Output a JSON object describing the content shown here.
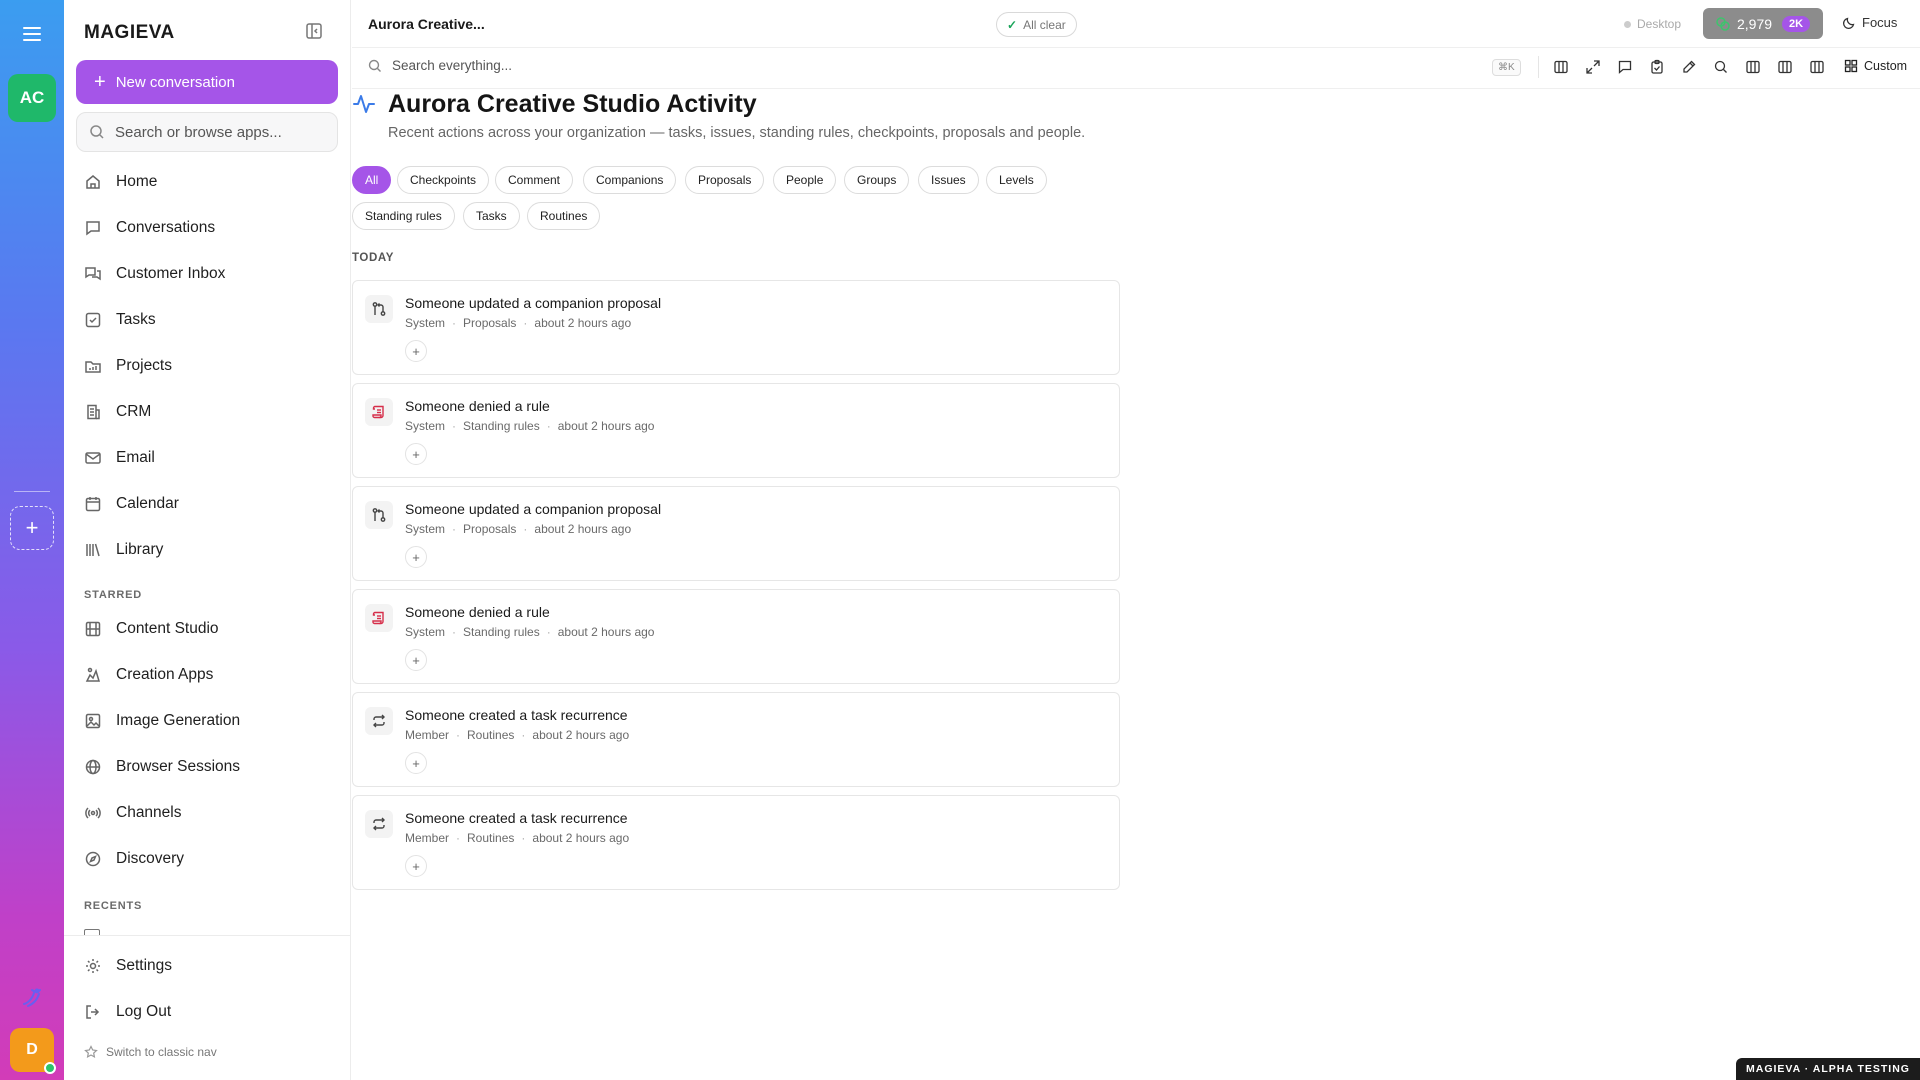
{
  "rail": {
    "workspace_initials": "AC",
    "user_initial": "D",
    "add_label": "+"
  },
  "sidebar": {
    "brand": "MAGIEVA",
    "new_conversation": "New conversation",
    "search_placeholder": "Search or browse apps...",
    "items": [
      {
        "label": "Home",
        "icon": "home-icon"
      },
      {
        "label": "Conversations",
        "icon": "chat-icon"
      },
      {
        "label": "Customer Inbox",
        "icon": "inbox-icon"
      },
      {
        "label": "Tasks",
        "icon": "checkbox-icon"
      },
      {
        "label": "Projects",
        "icon": "folder-icon"
      },
      {
        "label": "CRM",
        "icon": "building-icon"
      },
      {
        "label": "Email",
        "icon": "mail-icon"
      },
      {
        "label": "Calendar",
        "icon": "calendar-icon"
      },
      {
        "label": "Library",
        "icon": "library-icon"
      }
    ],
    "starred_label": "STARRED",
    "starred": [
      {
        "label": "Content Studio",
        "icon": "film-icon"
      },
      {
        "label": "Creation Apps",
        "icon": "apps-icon"
      },
      {
        "label": "Image Generation",
        "icon": "image-icon"
      },
      {
        "label": "Browser Sessions",
        "icon": "globe-icon"
      },
      {
        "label": "Channels",
        "icon": "broadcast-icon"
      },
      {
        "label": "Discovery",
        "icon": "compass-icon"
      }
    ],
    "recents_label": "RECENTS",
    "footer": {
      "settings": "Settings",
      "logout": "Log Out",
      "classic": "Switch to classic nav"
    }
  },
  "topbar": {
    "breadcrumb": "Aurora Creative...",
    "status": "All clear",
    "desktop": "Desktop",
    "credits": "2,979",
    "credits_badge": "2K",
    "focus": "Focus"
  },
  "searchbar": {
    "placeholder": "Search everything...",
    "shortcut": "⌘K",
    "custom": "Custom"
  },
  "page": {
    "title": "Aurora Creative Studio Activity",
    "subtitle": "Recent actions across your organization — tasks, issues, standing rules, checkpoints, proposals and people.",
    "filters_row1": [
      "All",
      "Checkpoints",
      "Comment",
      "Companions",
      "Proposals",
      "People",
      "Groups",
      "Issues",
      "Levels"
    ],
    "filters_row2": [
      "Standing rules",
      "Tasks",
      "Routines"
    ],
    "active_filter": "All",
    "section": "TODAY",
    "activities": [
      {
        "title": "Someone updated a companion proposal",
        "actor": "System",
        "category": "Proposals",
        "time": "about 2 hours ago",
        "icon": "merge-icon",
        "react": "+"
      },
      {
        "title": "Someone denied a rule",
        "actor": "System",
        "category": "Standing rules",
        "time": "about 2 hours ago",
        "icon": "scroll-icon",
        "react": "+"
      },
      {
        "title": "Someone updated a companion proposal",
        "actor": "System",
        "category": "Proposals",
        "time": "about 2 hours ago",
        "icon": "merge-icon",
        "react": "+"
      },
      {
        "title": "Someone denied a rule",
        "actor": "System",
        "category": "Standing rules",
        "time": "about 2 hours ago",
        "icon": "scroll-icon",
        "react": "+"
      },
      {
        "title": "Someone created a task recurrence",
        "actor": "Member",
        "category": "Routines",
        "time": "about 2 hours ago",
        "icon": "repeat-icon",
        "react": "+"
      },
      {
        "title": "Someone created a task recurrence",
        "actor": "Member",
        "category": "Routines",
        "time": "about 2 hours ago",
        "icon": "repeat-icon",
        "react": "+"
      }
    ]
  },
  "footer_badge": "MAGIEVA · ALPHA TESTING",
  "colors": {
    "accent": "#a555e8",
    "success": "#1fb86a",
    "danger": "#d62e4a"
  }
}
